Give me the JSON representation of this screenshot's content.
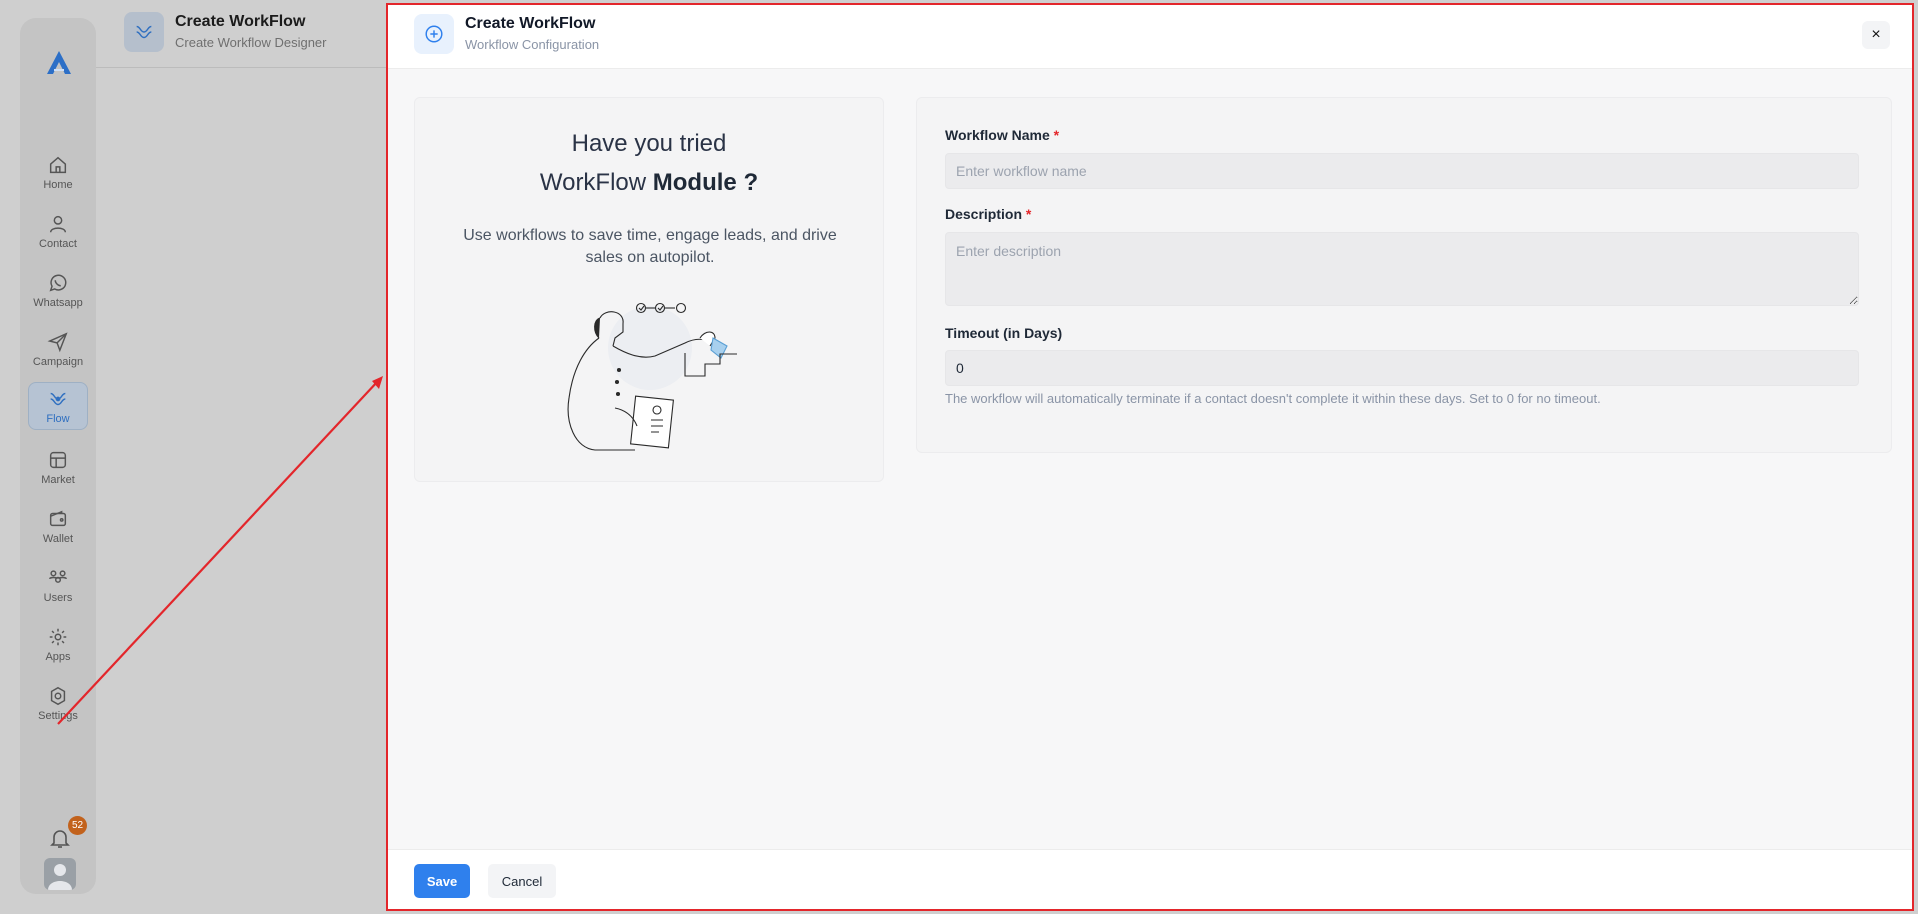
{
  "background_app": {
    "header": {
      "title": "Create WorkFlow",
      "subtitle": "Create Workflow Designer"
    },
    "sidebar": {
      "items": [
        {
          "label": "Home",
          "icon": "home-icon"
        },
        {
          "label": "Contact",
          "icon": "user-icon"
        },
        {
          "label": "Whatsapp",
          "icon": "whatsapp-icon"
        },
        {
          "label": "Campaign",
          "icon": "send-icon"
        },
        {
          "label": "Flow",
          "icon": "flow-icon",
          "active": true
        },
        {
          "label": "Market",
          "icon": "market-icon"
        },
        {
          "label": "Wallet",
          "icon": "wallet-icon"
        },
        {
          "label": "Users",
          "icon": "users-icon"
        },
        {
          "label": "Apps",
          "icon": "apps-icon"
        },
        {
          "label": "Settings",
          "icon": "settings-icon"
        }
      ],
      "notification_count": "52"
    }
  },
  "modal": {
    "title": "Create WorkFlow",
    "subtitle": "Workflow Configuration",
    "close_label": "×",
    "promo": {
      "line1": "Have you tried",
      "line2_prefix": "WorkFlow ",
      "line2_bold": "Module ?",
      "description": "Use workflows to save time, engage leads, and drive sales on autopilot."
    },
    "form": {
      "name_label": "Workflow Name",
      "name_placeholder": "Enter workflow name",
      "description_label": "Description",
      "description_placeholder": "Enter description",
      "timeout_label": "Timeout (in Days)",
      "timeout_value": "0",
      "timeout_help": "The workflow will automatically terminate if a contact doesn't complete it within these days. Set to 0 for no timeout.",
      "required_mark": "*"
    },
    "footer": {
      "save_label": "Save",
      "cancel_label": "Cancel"
    }
  },
  "colors": {
    "accent": "#2f80ed",
    "annotation": "#e3262b",
    "badge": "#c2621c"
  }
}
